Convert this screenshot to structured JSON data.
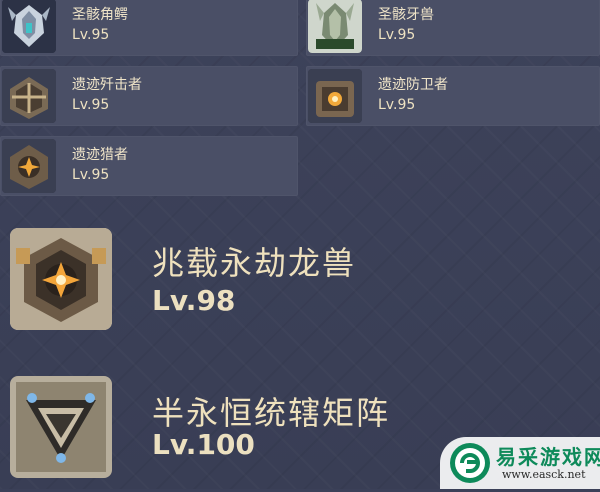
{
  "bosses_small": [
    {
      "name": "圣骸角鳄",
      "level": "Lv.95",
      "icon": "saurian-horned-icon"
    },
    {
      "name": "圣骸牙兽",
      "level": "Lv.95",
      "icon": "saurian-fanged-icon"
    },
    {
      "name": "遗迹歼击者",
      "level": "Lv.95",
      "icon": "ruin-destroyer-icon"
    },
    {
      "name": "遗迹防卫者",
      "level": "Lv.95",
      "icon": "ruin-defender-icon"
    },
    {
      "name": "遗迹猎者",
      "level": "Lv.95",
      "icon": "ruin-hunter-icon"
    }
  ],
  "bosses_large": [
    {
      "name": "兆载永劫龙兽",
      "level": "Lv.98",
      "icon": "aeonblight-drake-icon"
    },
    {
      "name": "半永恒统辖矩阵",
      "level": "Lv.100",
      "icon": "perpetual-mechanical-array-icon"
    }
  ],
  "watermark": {
    "title": "易采游戏网",
    "url": "www.easck.net"
  },
  "colors": {
    "background": "#3b4058",
    "card": "#4a4f66",
    "text": "#efe1bd",
    "watermark_green": "#0e8a5a"
  }
}
